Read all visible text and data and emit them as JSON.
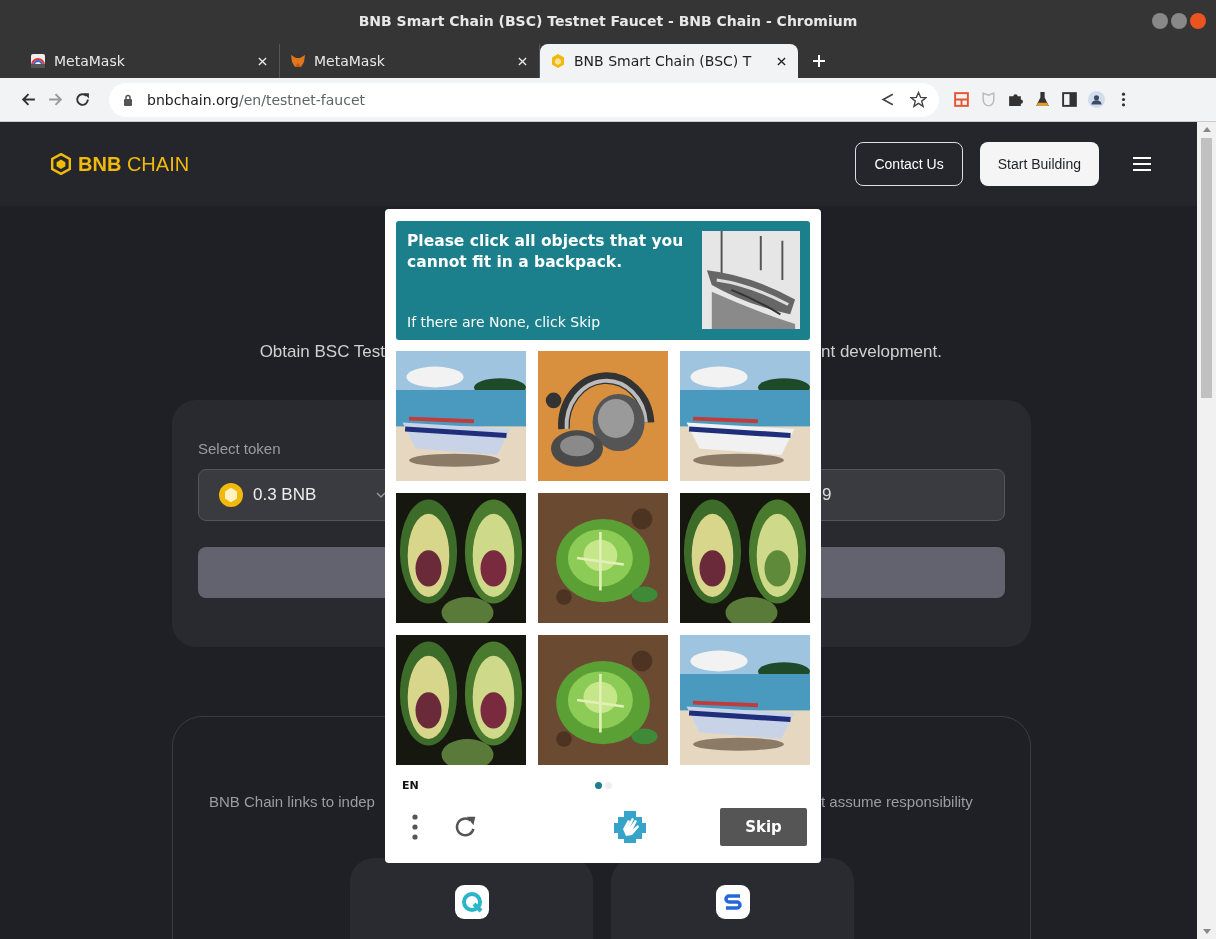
{
  "window": {
    "title": "BNB Smart Chain (BSC) Testnet Faucet - BNB Chain - Chromium"
  },
  "tabs": [
    {
      "label": "MetaMask",
      "selected": false,
      "kind": "rainbow"
    },
    {
      "label": "MetaMask",
      "selected": false,
      "kind": "fox"
    },
    {
      "label": "BNB Smart Chain (BSC) T",
      "selected": true,
      "kind": "cube"
    }
  ],
  "address_bar": {
    "host": "bnbchain.org",
    "path": "/en/testnet-faucet"
  },
  "header": {
    "logo": "**BNB** CHAIN",
    "buttons": [
      "Contact Us",
      "Start Building"
    ]
  },
  "intro": {
    "left": "Obtain BSC Test",
    "right": "nt development."
  },
  "faucet_card": {
    "label": "Select token",
    "token": "0.3 BNB",
    "address_tail": "9"
  },
  "links_card": {
    "left": "BNB Chain links to indep",
    "right": "t assume responsibility"
  },
  "captcha": {
    "prompt": "Please click all objects that you cannot fit in a backpack.",
    "hint": "If there are None, click Skip",
    "language": "EN",
    "pages": [
      {
        "selected": true
      },
      {
        "selected": false
      }
    ],
    "skip": "Skip"
  }
}
